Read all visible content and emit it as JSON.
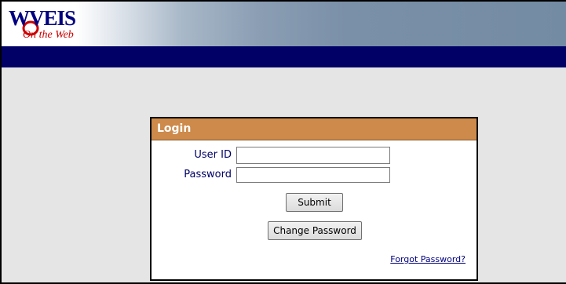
{
  "header": {
    "logo_text": "WVEIS",
    "logo_tagline": "On the Web",
    "colors": {
      "navbar": "#000066",
      "logo_blue": "#000080",
      "logo_red": "#cc0000"
    }
  },
  "login": {
    "title": "Login",
    "header_color": "#cd8a4a",
    "user_id_label": "User ID",
    "user_id_value": "",
    "password_label": "Password",
    "password_value": "",
    "submit_label": "Submit",
    "change_password_label": "Change Password",
    "forgot_password_label": "Forgot Password?"
  }
}
